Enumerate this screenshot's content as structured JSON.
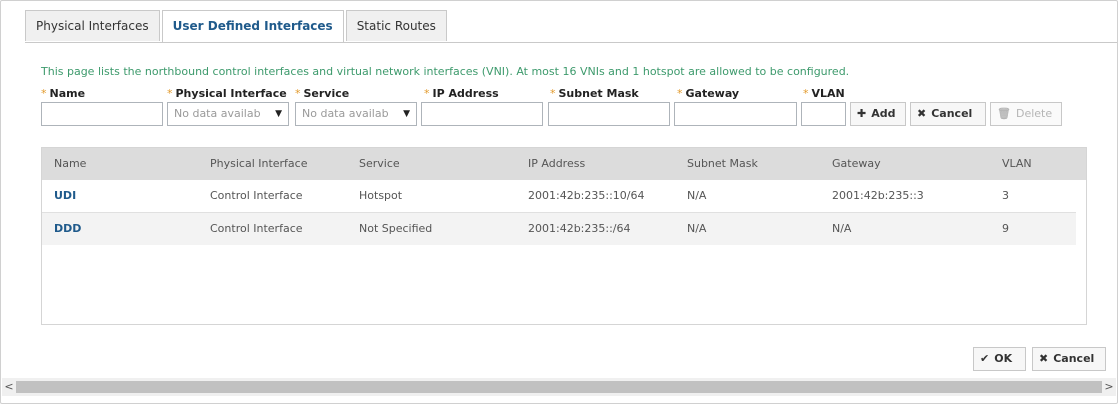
{
  "tabs": [
    {
      "label": "Physical Interfaces",
      "active": false
    },
    {
      "label": "User Defined Interfaces",
      "active": true
    },
    {
      "label": "Static Routes",
      "active": false
    }
  ],
  "info_text": "This page lists the northbound control interfaces and virtual network interfaces (VNI). At most 16 VNIs and 1 hotspot are allowed to be configured.",
  "form": {
    "required_mark": "*",
    "name_label": "Name",
    "name_value": "",
    "physical_interface_label": "Physical Interface",
    "physical_interface_value": "No data availab",
    "service_label": "Service",
    "service_value": "No data availab",
    "ip_address_label": "IP Address",
    "ip_address_value": "",
    "subnet_mask_label": "Subnet Mask",
    "subnet_mask_value": "",
    "gateway_label": "Gateway",
    "gateway_value": "",
    "vlan_label": "VLAN",
    "vlan_value": "",
    "add_label": "Add",
    "cancel_label": "Cancel",
    "delete_label": "Delete"
  },
  "table": {
    "columns": [
      "Name",
      "Physical Interface",
      "Service",
      "IP Address",
      "Subnet Mask",
      "Gateway",
      "VLAN"
    ],
    "rows": [
      {
        "name": "UDI",
        "physical_interface": "Control Interface",
        "service": "Hotspot",
        "ip_address": "2001:42b:235::10/64",
        "subnet_mask": "N/A",
        "gateway": "2001:42b:235::3",
        "vlan": "3"
      },
      {
        "name": "DDD",
        "physical_interface": "Control Interface",
        "service": "Not Specified",
        "ip_address": "2001:42b:235::/64",
        "subnet_mask": "N/A",
        "gateway": "N/A",
        "vlan": "9"
      }
    ]
  },
  "footer": {
    "ok_label": "OK",
    "cancel_label": "Cancel"
  },
  "icons": {
    "add": "plus-icon",
    "cancel": "x-icon",
    "delete": "trash-icon",
    "ok": "check-icon",
    "dropdown": "caret-down-icon"
  },
  "colors": {
    "accent": "#1f5a8b",
    "info_text": "#3d9a6c",
    "required": "#e29a2b",
    "header_bg": "#dcdcdc"
  }
}
